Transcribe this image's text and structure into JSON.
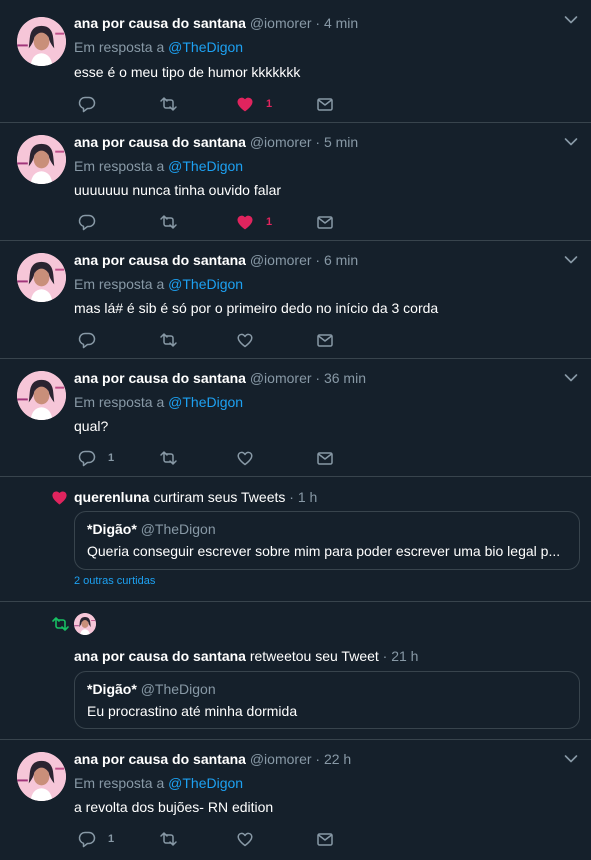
{
  "accent_color": "#1da1f2",
  "like_color": "#e0245e",
  "retweet_color": "#17bf63",
  "tweets": [
    {
      "name": "ana por causa do santana",
      "handle": "@iomorer",
      "time": "· 4 min",
      "reply_prefix": "Em resposta a",
      "reply_to": "@TheDigon",
      "text": "esse é o meu tipo de humor kkkkkkk",
      "reply_count": "",
      "like_count": "1",
      "liked": true
    },
    {
      "name": "ana por causa do santana",
      "handle": "@iomorer",
      "time": "· 5 min",
      "reply_prefix": "Em resposta a",
      "reply_to": "@TheDigon",
      "text": "uuuuuuu nunca tinha ouvido falar",
      "reply_count": "",
      "like_count": "1",
      "liked": true
    },
    {
      "name": "ana por causa do santana",
      "handle": "@iomorer",
      "time": "· 6 min",
      "reply_prefix": "Em resposta a",
      "reply_to": "@TheDigon",
      "text": "mas lá# é sib é só por o primeiro dedo no início da 3 corda",
      "reply_count": "",
      "like_count": "",
      "liked": false
    },
    {
      "name": "ana por causa do santana",
      "handle": "@iomorer",
      "time": "· 36 min",
      "reply_prefix": "Em resposta a",
      "reply_to": "@TheDigon",
      "text": "qual?",
      "reply_count": "1",
      "like_count": "",
      "liked": false
    }
  ],
  "like_notification": {
    "user": "querenluna",
    "action": "curtiram seus Tweets",
    "time": "· 1 h",
    "quote_name": "*Digão*",
    "quote_handle": "@TheDigon",
    "quote_text": "Queria conseguir escrever sobre mim para poder escrever uma bio legal p...",
    "more": "2 outras curtidas"
  },
  "retweet_notification": {
    "user": "ana por causa do santana",
    "action": "retweetou seu Tweet",
    "time": "· 21 h",
    "quote_name": "*Digão*",
    "quote_handle": "@TheDigon",
    "quote_text": "Eu procrastino até minha dormida"
  },
  "last_tweet": {
    "name": "ana por causa do santana",
    "handle": "@iomorer",
    "time": "· 22 h",
    "reply_prefix": "Em resposta a",
    "reply_to": "@TheDigon",
    "text": "a revolta dos bujões- RN edition",
    "reply_count": "1",
    "like_count": "",
    "liked": false
  }
}
